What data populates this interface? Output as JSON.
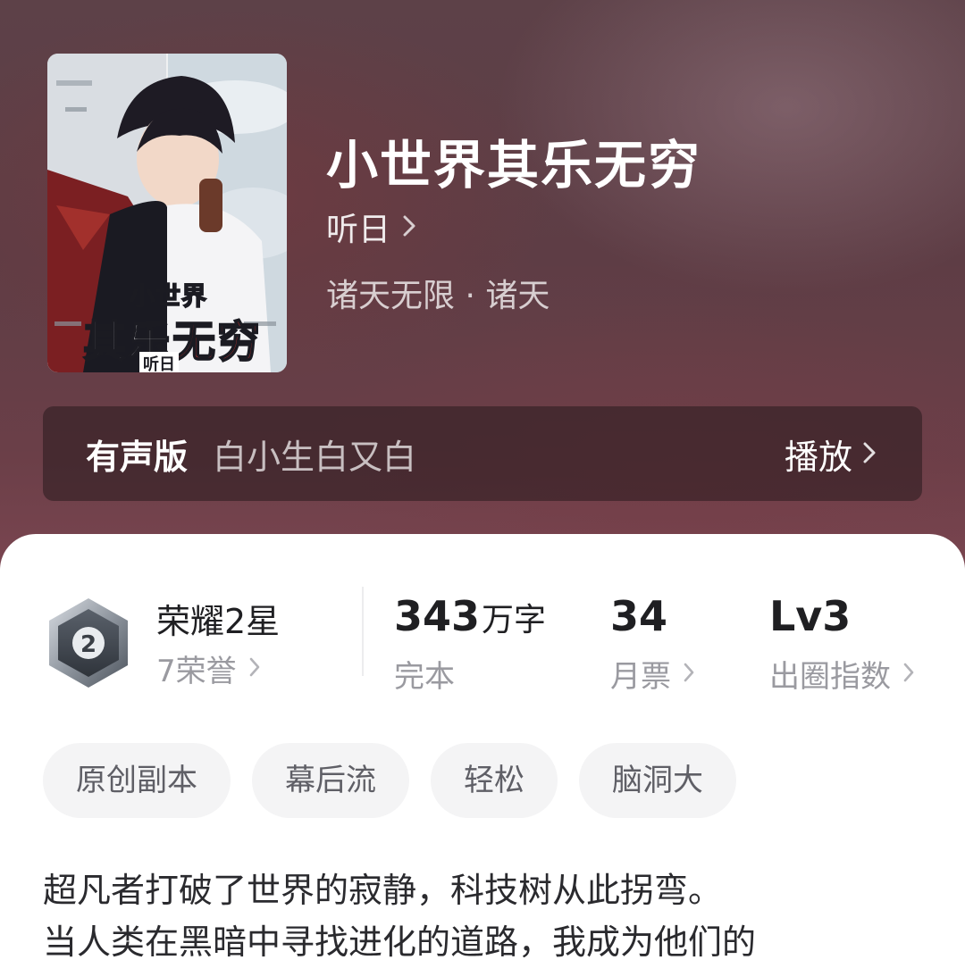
{
  "book": {
    "title": "小世界其乐无穷",
    "author": "听日",
    "genre": "诸天无限 · 诸天",
    "cover": {
      "title_line1": "小世界",
      "title_line2_a": "其乐",
      "title_line2_b": "无穷",
      "author": "听日"
    }
  },
  "audio": {
    "label": "有声版",
    "narrator": "白小生白又白",
    "play_label": "播放"
  },
  "stats": {
    "honor": {
      "title": "荣耀2星",
      "sub": "7荣誉",
      "medal_number": "2"
    },
    "words": {
      "value": "343",
      "unit": "万字",
      "sub": "完本"
    },
    "tickets": {
      "value": "34",
      "sub": "月票"
    },
    "influence": {
      "value": "Lv3",
      "sub": "出圈指数"
    }
  },
  "tags": [
    "原创副本",
    "幕后流",
    "轻松",
    "脑洞大"
  ],
  "description": {
    "line1": "超凡者打破了世界的寂静，科技树从此拐弯。",
    "line2": "当人类在黑暗中寻找进化的道路，我成为他们的"
  },
  "icons": {
    "chevron": "chevron-right-icon",
    "medal": "honor-medal-icon"
  },
  "colors": {
    "hero_bg": "#5e3d45",
    "text_primary": "#1f1f22",
    "text_secondary": "#9a9aa0",
    "tag_bg": "#f4f4f5",
    "cover_red": "#d8322e"
  }
}
